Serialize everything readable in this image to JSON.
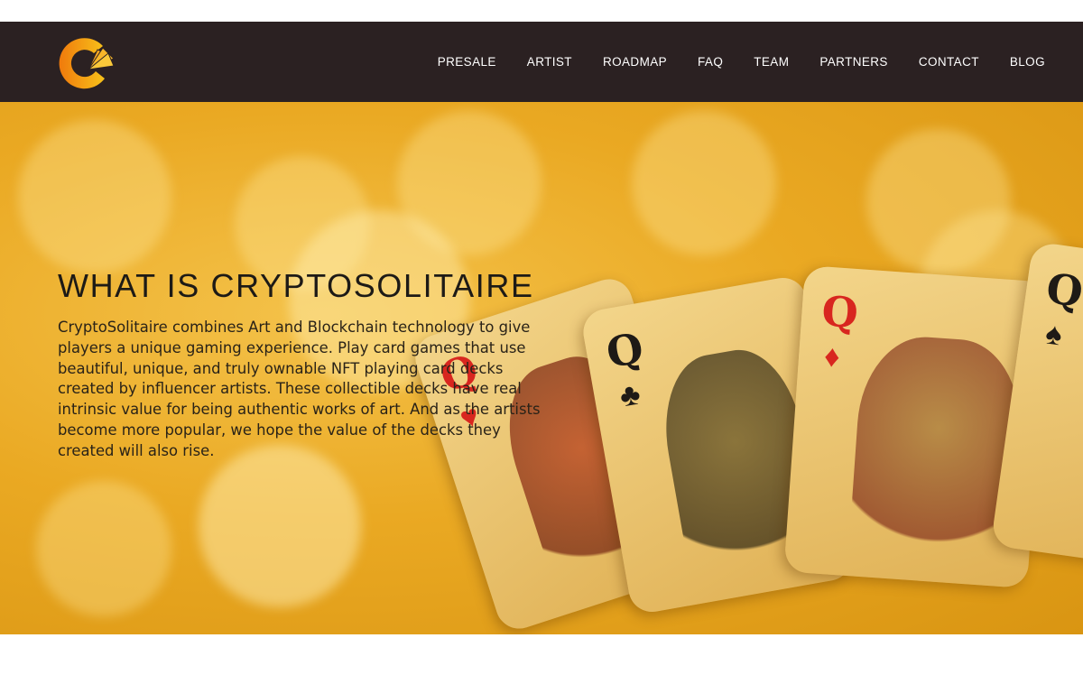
{
  "nav": {
    "items": [
      "PRESALE",
      "ARTIST",
      "ROADMAP",
      "FAQ",
      "TEAM",
      "PARTNERS",
      "CONTACT",
      "BLOG"
    ]
  },
  "hero": {
    "title": "WHAT IS CRYPTOSOLITAIRE",
    "body": "CryptoSolitaire combines Art and Blockchain technology to give players a unique gaming experience. Play card games that use beautiful, unique, and truly ownable NFT playing card decks created by influencer artists. These collectible decks have real intrinsic value for being authentic works of art. And as the artists become more popular, we hope the value of the decks they created will also rise.",
    "cards": [
      {
        "rank": "Q",
        "suit": "♥",
        "color": "#d8261f"
      },
      {
        "rank": "Q",
        "suit": "♣",
        "color": "#1e1a16"
      },
      {
        "rank": "Q",
        "suit": "♦",
        "color": "#d8261f"
      },
      {
        "rank": "Q",
        "suit": "♠",
        "color": "#1e1a16"
      }
    ]
  },
  "colors": {
    "header_bg": "#2b2122",
    "accent": "#f0a81c"
  }
}
